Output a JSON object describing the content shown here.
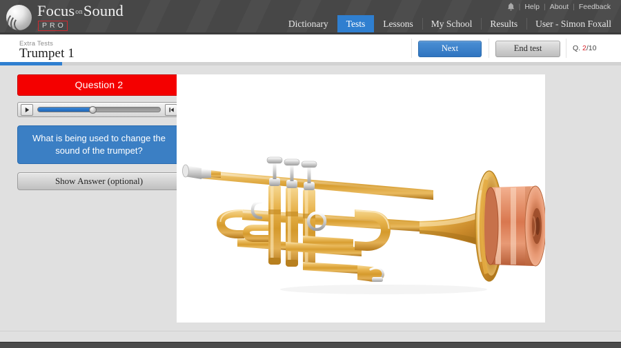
{
  "header": {
    "logo": {
      "title_part1": "Focus",
      "title_on": "on",
      "title_part2": "Sound",
      "badge": "PRO",
      "mark_icon": "sound-wave-logo-icon"
    },
    "utility": {
      "bell_icon": "bell-icon",
      "links": [
        "Help",
        "About",
        "Feedback"
      ],
      "separator": "|"
    },
    "nav": [
      {
        "label": "Dictionary",
        "active": false
      },
      {
        "label": "Tests",
        "active": true
      },
      {
        "label": "Lessons",
        "active": false
      },
      {
        "label": "My School",
        "active": false
      },
      {
        "label": "Results",
        "active": false
      },
      {
        "label": "User - Simon Foxall",
        "active": false
      }
    ],
    "accent_color": "#2f7fd0",
    "background_color": "#474747"
  },
  "subheader": {
    "breadcrumb": "Extra Tests",
    "title": "Trumpet 1",
    "next_label": "Next",
    "end_test_label": "End test",
    "question_counter_prefix": "Q.",
    "question_current": "2",
    "question_separator": "/",
    "question_total": "10",
    "progress_percent": 10
  },
  "left_panel": {
    "question_banner": "Question 2",
    "question_banner_color": "#f40000",
    "player": {
      "play_icon": "play-icon",
      "restart_icon": "skip-to-start-icon",
      "progress_percent": 45
    },
    "question_text": "What is being used to change the sound of the trumpet?",
    "question_text_color": "#3b7fc4",
    "show_answer_label": "Show Answer (optional)"
  },
  "media": {
    "image_alt": "trumpet-with-straight-mute",
    "background_color": "#ffffff",
    "brass_color": "#e0a73a",
    "mute_color": "#e08a63"
  }
}
